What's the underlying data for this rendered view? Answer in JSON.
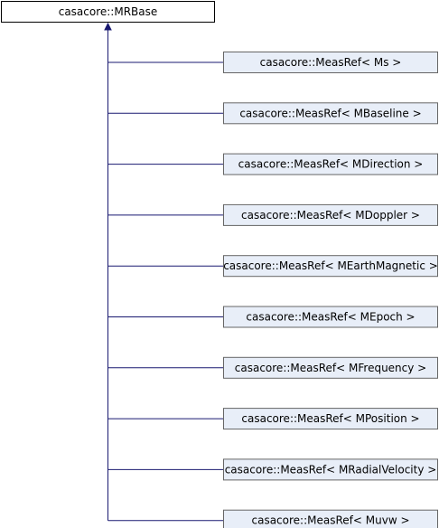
{
  "base_class": {
    "label": "casacore::MRBase"
  },
  "derived_classes": [
    {
      "label": "casacore::MeasRef< Ms >"
    },
    {
      "label": "casacore::MeasRef< MBaseline >"
    },
    {
      "label": "casacore::MeasRef< MDirection >"
    },
    {
      "label": "casacore::MeasRef< MDoppler >"
    },
    {
      "label": "casacore::MeasRef< MEarthMagnetic >"
    },
    {
      "label": "casacore::MeasRef< MEpoch >"
    },
    {
      "label": "casacore::MeasRef< MFrequency >"
    },
    {
      "label": "casacore::MeasRef< MPosition >"
    },
    {
      "label": "casacore::MeasRef< MRadialVelocity >"
    },
    {
      "label": "casacore::MeasRef< Muvw >"
    }
  ],
  "colors": {
    "edge": "#191970",
    "derived_fill": "#e8eef8",
    "base_fill": "#ffffff"
  }
}
